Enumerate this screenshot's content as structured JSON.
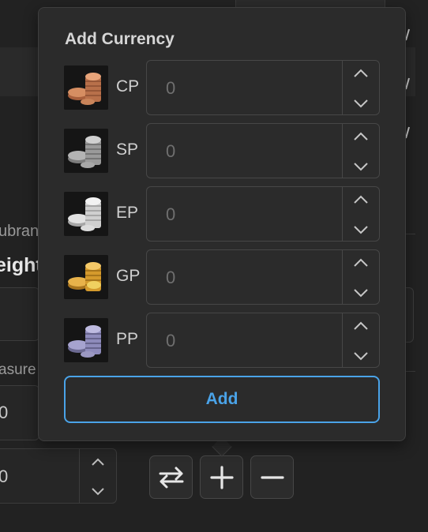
{
  "background": {
    "label_partial": "ubran",
    "weight_partial": "eight",
    "measure_partial": "asure",
    "field_value_b": "0",
    "stepper_value": "0"
  },
  "popover": {
    "title": "Add Currency",
    "currencies": [
      {
        "code": "CP",
        "value": "",
        "placeholder": "0",
        "icon": "copper-coins-icon"
      },
      {
        "code": "SP",
        "value": "",
        "placeholder": "0",
        "icon": "silver-coins-icon"
      },
      {
        "code": "EP",
        "value": "",
        "placeholder": "0",
        "icon": "electrum-coins-icon"
      },
      {
        "code": "GP",
        "value": "",
        "placeholder": "0",
        "icon": "gold-coins-icon"
      },
      {
        "code": "PP",
        "value": "",
        "placeholder": "0",
        "icon": "platinum-coins-icon"
      }
    ],
    "add_label": "Add"
  },
  "toolbar": {
    "icons": [
      "swap-arrows-icon",
      "plus-icon",
      "minus-icon"
    ]
  },
  "colors": {
    "accent": "#4aa3e8",
    "panel": "#2b2b2b",
    "background": "#222222",
    "copper": "#c9845a",
    "silver": "#a8a8a8",
    "electrum": "#dcdcdc",
    "gold": "#e2a93a",
    "platinum": "#9b98c2"
  }
}
